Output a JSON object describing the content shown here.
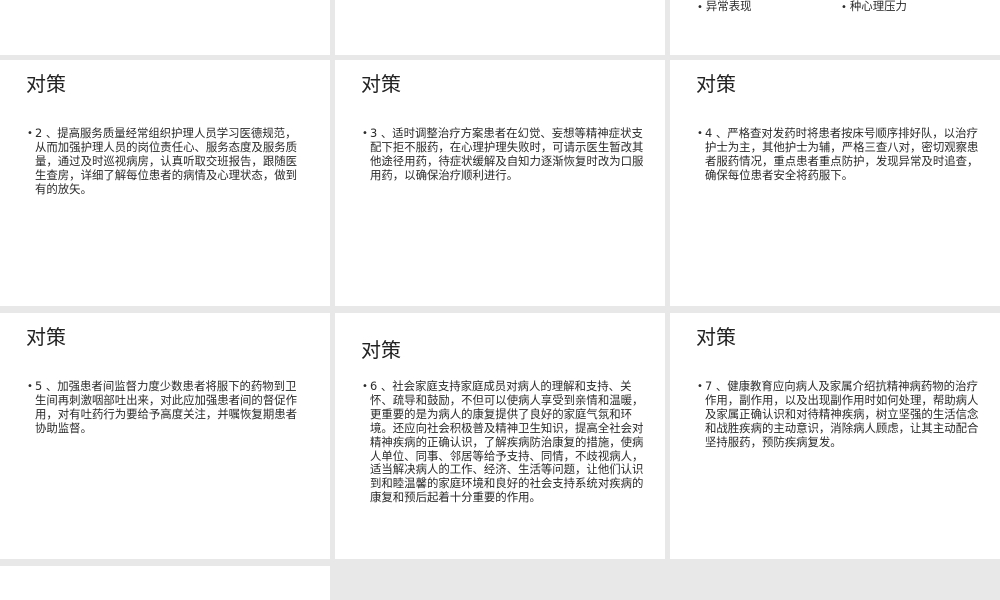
{
  "top_row": {
    "left_fragment": "异常表现",
    "right_fragment": "种心理压力"
  },
  "slides": [
    {
      "title": "对策",
      "bullet": "2 、提高服务质量经常组织护理人员学习医德规范，从而加强护理人员的岗位责任心、服务态度及服务质量，通过及时巡视病房，认真听取交班报告，跟随医生查房，详细了解每位患者的病情及心理状态，做到有的放矢。"
    },
    {
      "title": "对策",
      "bullet": "3 、适时调整治疗方案患者在幻觉、妄想等精神症状支配下拒不服药，在心理护理失败时，可请示医生暂改其他途径用药，待症状缓解及自知力逐渐恢复时改为口服用药，以确保治疗顺利进行。"
    },
    {
      "title": "对策",
      "bullet": "4 、严格查对发药时将患者按床号顺序排好队，以治疗护士为主，其他护士为辅，严格三查八对，密切观察患者服药情况，重点患者重点防护，发现异常及时追查，确保每位患者安全将药服下。"
    },
    {
      "title": "对策",
      "bullet": "5 、加强患者间监督力度少数患者将服下的药物到卫生间再刺激咽部吐出来，对此应加强患者间的督促作用，对有吐药行为要给予高度关注，并嘱恢复期患者协助监督。"
    },
    {
      "title": "对策",
      "bullet": "6 、社会家庭支持家庭成员对病人的理解和支持、关怀、疏导和鼓励，不但可以使病人享受到亲情和温暖，更重要的是为病人的康复提供了良好的家庭气氛和环境。还应向社会积极普及精神卫生知识，提高全社会对精神疾病的正确认识，了解疾病防治康复的措施，使病人单位、同事、邻居等给予支持、同情，不歧视病人，适当解决病人的工作、经济、生活等问题，让他们认识到和睦温馨的家庭环境和良好的社会支持系统对疾病的康复和预后起着十分重要的作用。"
    },
    {
      "title": "对策",
      "bullet": "7 、健康教育应向病人及家属介绍抗精神病药物的治疗作用，副作用，以及出现副作用时如何处理，帮助病人及家属正确认识和对待精神疾病，树立坚强的生活信念和战胜疾病的主动意识，消除病人顾虑，让其主动配合坚持服药，预防疾病复发。"
    }
  ],
  "bullet_symbol": "•"
}
